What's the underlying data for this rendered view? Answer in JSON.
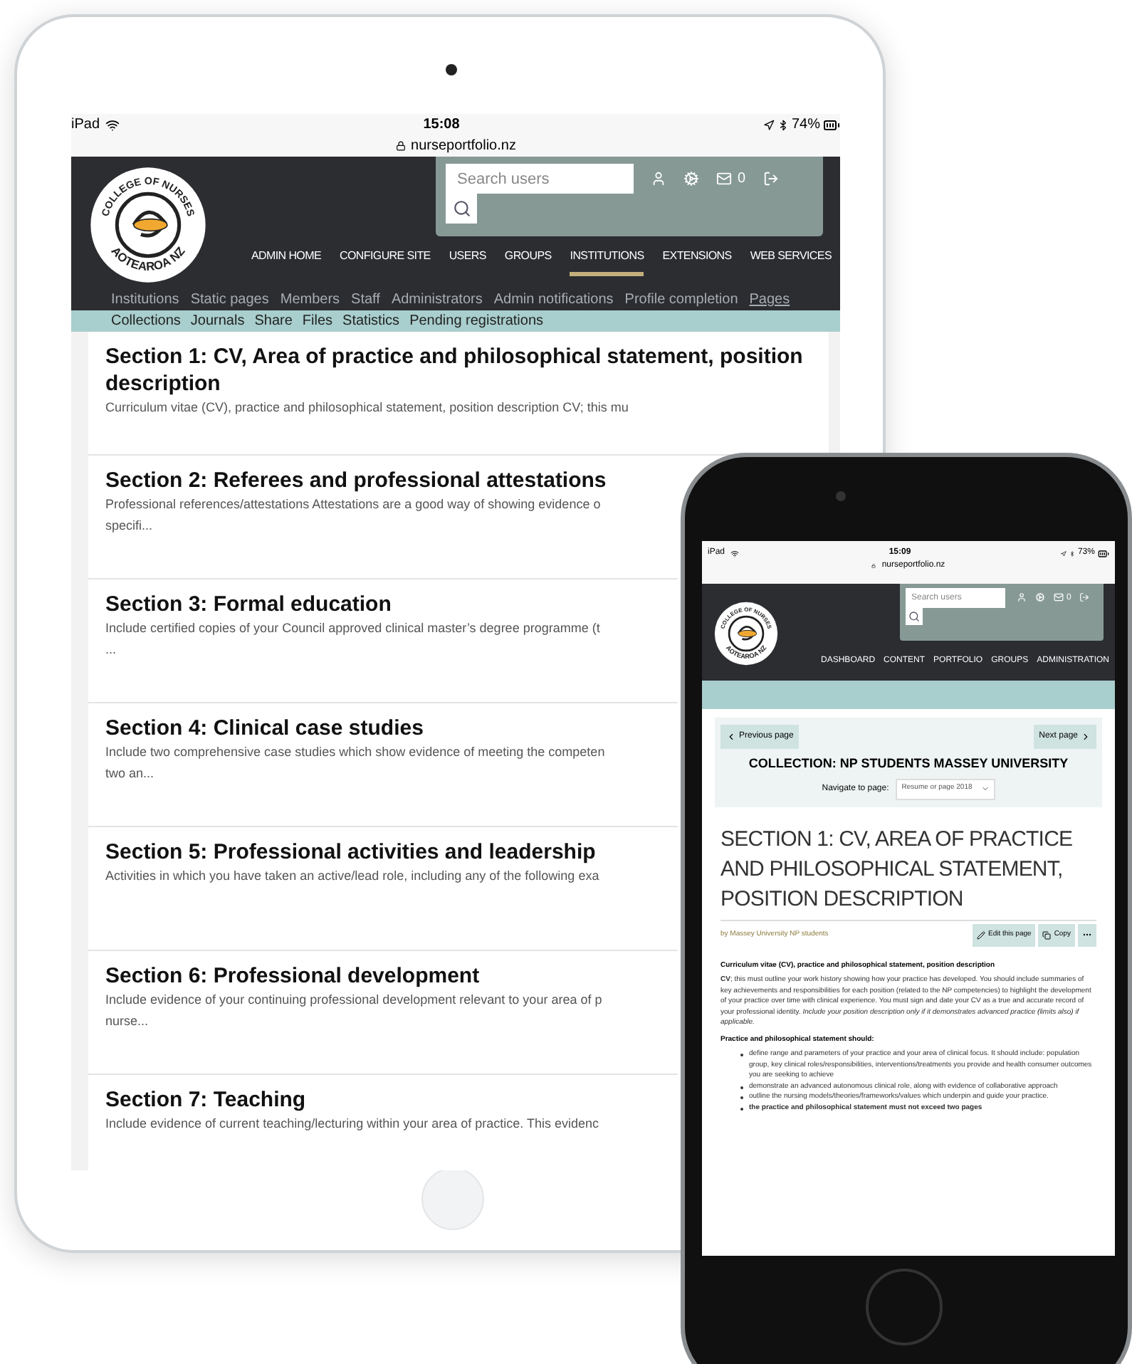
{
  "tablet": {
    "status": {
      "device": "iPad",
      "time": "15:08",
      "url": "nurseportfolio.nz",
      "battery": "74%"
    },
    "logo": {
      "top": "COLLEGE OF NURSES",
      "bottom": "AOTEAROA NZ"
    },
    "search": {
      "placeholder": "Search users"
    },
    "mail_count": "0",
    "nav": [
      {
        "label": "ADMIN HOME",
        "selected": false
      },
      {
        "label": "CONFIGURE SITE",
        "selected": false
      },
      {
        "label": "USERS",
        "selected": false
      },
      {
        "label": "GROUPS",
        "selected": false
      },
      {
        "label": "INSTITUTIONS",
        "selected": true
      },
      {
        "label": "EXTENSIONS",
        "selected": false
      },
      {
        "label": "WEB SERVICES",
        "selected": false
      }
    ],
    "subnav": [
      {
        "label": "Institutions",
        "selected": false
      },
      {
        "label": "Static pages",
        "selected": false
      },
      {
        "label": "Members",
        "selected": false
      },
      {
        "label": "Staff",
        "selected": false
      },
      {
        "label": "Administrators",
        "selected": false
      },
      {
        "label": "Admin notifications",
        "selected": false
      },
      {
        "label": "Profile completion",
        "selected": false
      },
      {
        "label": "Pages",
        "selected": true
      }
    ],
    "subnav2": [
      "Collections",
      "Journals",
      "Share",
      "Files",
      "Statistics",
      "Pending registrations"
    ],
    "sections": [
      {
        "title": "Section 1: CV, Area of practice and philosophical statement, position description",
        "lines": [
          "Curriculum vitae (CV), practice and philosophical statement, position description  CV; this mu"
        ]
      },
      {
        "title": "Section 2: Referees and professional attestations",
        "lines": [
          "Professional references/attestations  Attestations are a good way of showing evidence o",
          "specifi..."
        ]
      },
      {
        "title": "Section 3: Formal education",
        "lines": [
          "Include certified copies of your Council approved clinical master’s degree programme (t",
          "..."
        ]
      },
      {
        "title": "Section 4: Clinical case studies",
        "lines": [
          "Include two comprehensive case studies which show evidence of meeting the competen",
          "two an..."
        ]
      },
      {
        "title": "Section 5: Professional activities and leadership",
        "lines": [
          "Activities in which you have taken an active/lead role, including any of the following exa"
        ]
      },
      {
        "title": "Section 6: Professional development",
        "lines": [
          "Include evidence of your continuing professional development relevant to your area of p",
          "nurse..."
        ]
      },
      {
        "title": "Section 7: Teaching",
        "lines": [
          "Include evidence of current teaching/lecturing within your area of practice. This evidenc"
        ]
      }
    ]
  },
  "phone": {
    "status": {
      "device": "iPad",
      "time": "15:09",
      "url": "nurseportfolio.nz",
      "battery": "73%"
    },
    "logo": {
      "top": "COLLEGE OF NURSES",
      "bottom": "AOTEAROA NZ"
    },
    "search": {
      "placeholder": "Search users"
    },
    "mail_count": "0",
    "nav": [
      {
        "label": "DASHBOARD"
      },
      {
        "label": "CONTENT"
      },
      {
        "label": "PORTFOLIO"
      },
      {
        "label": "GROUPS"
      },
      {
        "label": "ADMINISTRATION"
      }
    ],
    "previous": "Previous page",
    "next": "Next page",
    "collection": "COLLECTION: NP STUDENTS MASSEY UNIVERSITY",
    "navigate_label": "Navigate to page:",
    "navigate_value": "Resume or page 2018",
    "title": "SECTION 1: CV, AREA OF PRACTICE AND PHILOSOPHICAL STATEMENT, POSITION DESCRIPTION",
    "byline": "by Massey University NP students",
    "edit": "Edit this page",
    "copy": "Copy",
    "heading": "Curriculum vitae (CV), practice and philosophical statement, position description",
    "paragraph": "**CV**; this must outline your work history showing how your practice has developed. You should include summaries of key achievements and responsibilities for each position (related to the NP competencies) to highlight the development of your practice over time with clinical experience. You must sign and date your CV as a true and accurate record of your professional identity. *Include your position description only if it demonstrates advanced practice (limits also) if applicable.*",
    "subheading": "Practice and philosophical statement should:",
    "bullets": [
      {
        "text": "define range and parameters of your practice and your area of clinical focus. It should include: population group, key clinical roles/responsibilities, interventions/treatments you provide and health consumer outcomes you are seeking to achieve",
        "bold": false
      },
      {
        "text": "demonstrate an advanced autonomous clinical role, along with evidence of collaborative approach",
        "bold": false
      },
      {
        "text": "outline the nursing models/theories/frameworks/values which underpin and guide your practice.",
        "bold": false
      },
      {
        "text": "the practice and philosophical statement must not exceed two pages",
        "bold": true
      }
    ]
  }
}
